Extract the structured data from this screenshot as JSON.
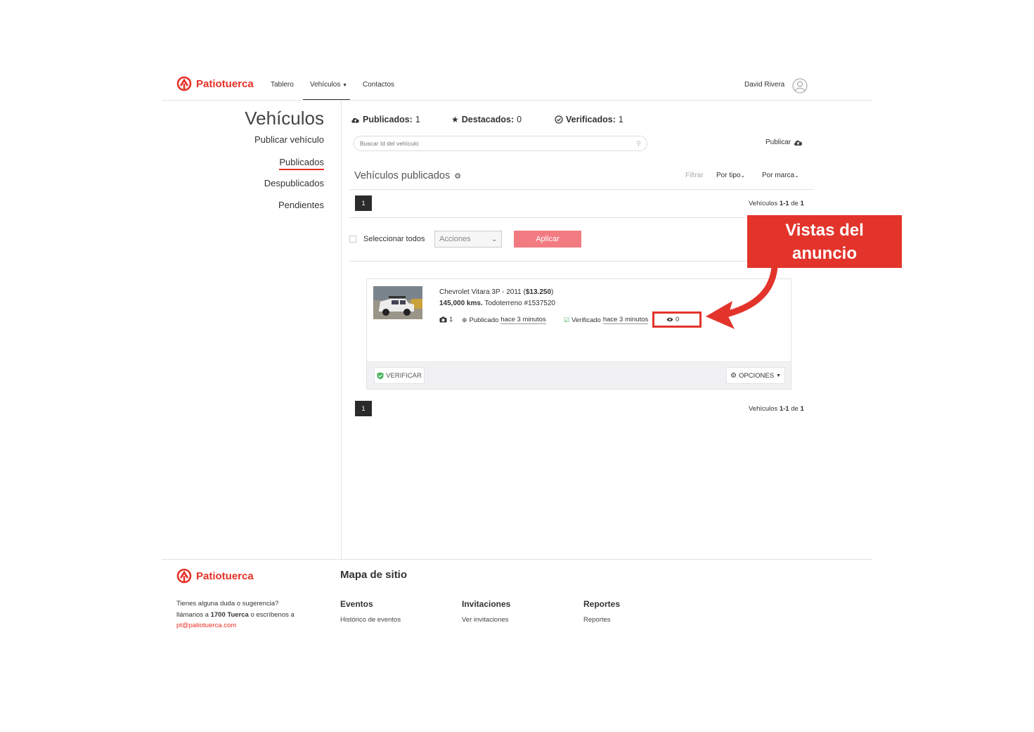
{
  "header": {
    "brand": "Patiotuerca",
    "nav": [
      {
        "label": "Tablero"
      },
      {
        "label": "Vehículos"
      },
      {
        "label": "Contactos"
      }
    ],
    "user_name": "David Rivera"
  },
  "sidebar": {
    "title": "Vehículos",
    "items": [
      {
        "label": "Publicar vehículo"
      },
      {
        "label": "Publicados"
      },
      {
        "label": "Despublicados"
      },
      {
        "label": "Pendientes"
      }
    ]
  },
  "stats": {
    "published_label": "Publicados:",
    "published_value": "1",
    "featured_label": "Destacados:",
    "featured_value": "0",
    "verified_label": "Verificados:",
    "verified_value": "1"
  },
  "search": {
    "placeholder": "Buscar Id del vehículo"
  },
  "publish_button": "Publicar",
  "section": {
    "title": "Vehículos publicados",
    "filter_label": "Filtrar",
    "by_type": "Por tipo",
    "by_brand": "Por marca"
  },
  "pagination": {
    "page": "1",
    "range_prefix": "Vehículos",
    "range": "1-1",
    "of": "de",
    "total": "1"
  },
  "bulk": {
    "select_all": "Seleccionar todos",
    "actions_placeholder": "Acciones",
    "apply": "Aplicar"
  },
  "vehicle": {
    "title": "Chevrolet Vitara 3P - 2011 (",
    "price": "$13.250",
    "title_close": ")",
    "km": "145,000 kms.",
    "subtitle": "Todoterreno #1537520",
    "photos": "1",
    "published_prefix": "Publicado",
    "published_time": "hace 3 minutos",
    "verified_prefix": "Verificado",
    "verified_time": "hace 3 minutos",
    "views": "0",
    "verify_button": "VERIFICAR",
    "options_button": "OPCIONES"
  },
  "callout": {
    "line1": "Vistas del",
    "line2": "anuncio"
  },
  "footer": {
    "brand": "Patiotuerca",
    "sitemap_title": "Mapa de sitio",
    "help_line1": "Tienes alguna duda o sugerencia?",
    "help_line2_prefix": "llámanos a",
    "help_phone": "1700 Tuerca",
    "help_line2_suffix": "o escríbenos a",
    "help_email": "pt@patiotuerca.com",
    "columns": [
      {
        "heading": "Eventos",
        "link": "Histórico de eventos"
      },
      {
        "heading": "Invitaciones",
        "link": "Ver invitaciones"
      },
      {
        "heading": "Reportes",
        "link": "Reportes"
      }
    ]
  },
  "colors": {
    "brand_red": "#e63027",
    "apply_pink": "#f27b82",
    "callout_red": "#e3342b"
  }
}
